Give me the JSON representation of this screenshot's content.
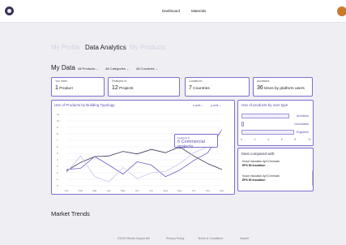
{
  "header": {
    "nav": [
      "Dashboard",
      "Materials"
    ]
  },
  "tabs": [
    "My Profile",
    "Data Analytics",
    "My Products"
  ],
  "section": {
    "title": "My Data",
    "filters": [
      "All Products",
      "All Categories",
      "All Countries"
    ]
  },
  "stats": [
    {
      "label": "You have:",
      "number": "1",
      "unit": "Product"
    },
    {
      "label": "Featured in:",
      "number": "12",
      "unit": "Projects"
    },
    {
      "label": "Located in:",
      "number": "7",
      "unit": "Countries"
    },
    {
      "label": "Accessed:",
      "number": "36",
      "unit": "times by platform users"
    }
  ],
  "chart_panel": {
    "title": "Use of Products by Building Typology",
    "xaxis_select": "x-axis",
    "yaxis_select": "y-axis",
    "tooltip_label": "Featured In",
    "tooltip_value": "6 Commercial projects"
  },
  "chart_data": {
    "type": "line",
    "x": [
      "Jan",
      "Feb",
      "Mar",
      "Apr",
      "May",
      "Jun",
      "Jul",
      "Aug",
      "Sep",
      "Oct",
      "Nov",
      "Dec"
    ],
    "yticks": [
      0,
      1,
      2,
      3,
      4,
      5,
      6,
      7,
      8,
      9,
      10,
      11
    ],
    "ylim": [
      0,
      11
    ],
    "series": [
      {
        "values": [
          2.3,
          3.6,
          4.5,
          4.6,
          5.3,
          4.9,
          5.6,
          5.1,
          6.0,
          4.6,
          3.4,
          2.5
        ]
      },
      {
        "values": [
          2.5,
          2.7,
          4.5,
          3.2,
          1.8,
          3.7,
          3.2,
          1.4,
          2.4,
          3.9,
          5.1,
          8.7
        ]
      },
      {
        "values": [
          2.0,
          4.6,
          1.4,
          0.6,
          2.8,
          1.1,
          2.0,
          2.2,
          3.4,
          5.1,
          6.0,
          8.7
        ]
      }
    ],
    "highlight": {
      "x": "Sep",
      "y": 6
    }
  },
  "user_type_panel": {
    "title": "Use of products by user type",
    "bars": [
      {
        "label": "Architects",
        "value": 6.9
      },
      {
        "label": "Consultants",
        "value": 0.1
      },
      {
        "label": "Engineers",
        "value": 7.6
      }
    ],
    "xticks": [
      "0",
      "2",
      "4",
      "6",
      "8",
      "10"
    ]
  },
  "most_compared": {
    "title": "Most compared with:",
    "items": [
      {
        "line1": "Knauf Insulation ApS Denmark",
        "line2": "EPS 80 Insulation"
      },
      {
        "line1": "Knauf Insulation ApS Denmark",
        "line2": "EPS 80 Insulation"
      }
    ]
  },
  "market": {
    "title": "Market Trends"
  },
  "footer": {
    "links": [
      "©2023 Rendo Impact AB",
      "Privacy Policy",
      "Terms & Conditions",
      "Imprint"
    ]
  },
  "colors": {
    "accent": "#7b6fd0",
    "line_purple": "#6a5dc6",
    "line_dark": "#3a3356",
    "line_light": "#c9c3ea",
    "background": "#efeff3",
    "avatar": "#c87a2a"
  },
  "icons": {
    "logo": "app-logo-icon",
    "avatar": "user-avatar"
  }
}
